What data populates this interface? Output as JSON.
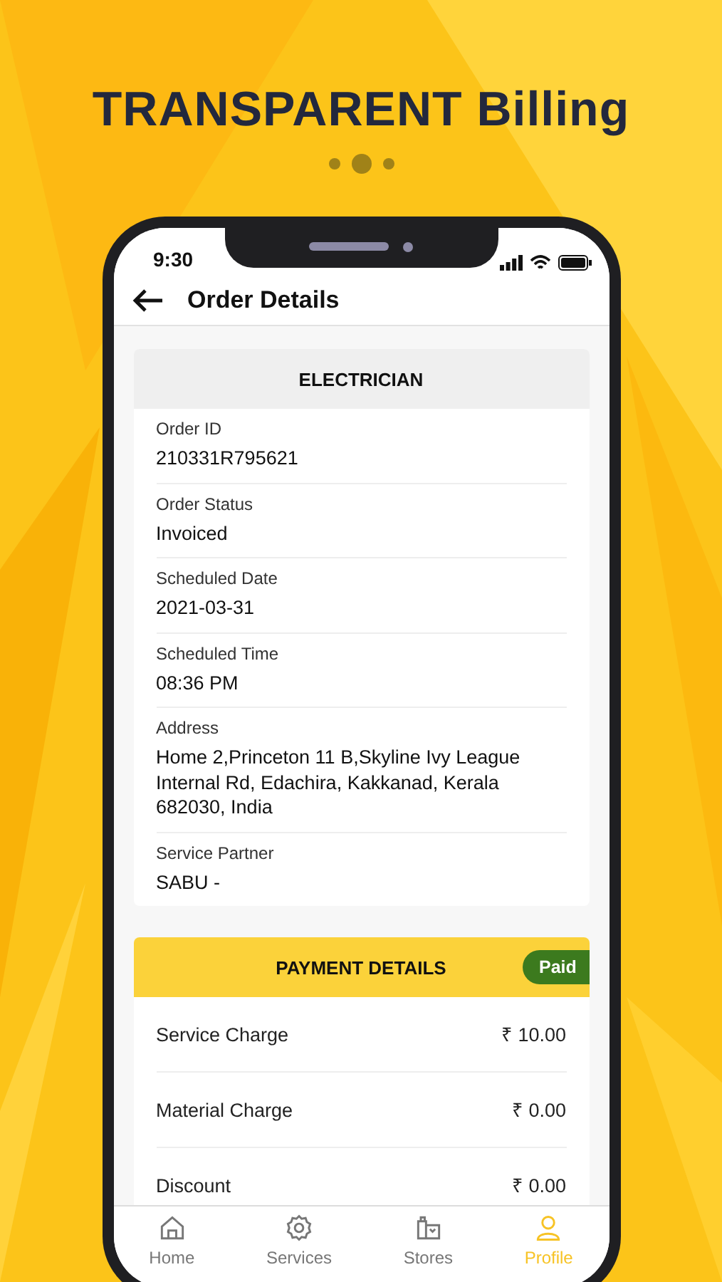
{
  "headline": "TRANSPARENT Billing",
  "pager": [
    {
      "selected": false
    },
    {
      "selected": true
    },
    {
      "selected": false
    }
  ],
  "status_bar": {
    "time": "9:30"
  },
  "header": {
    "title": "Order Details"
  },
  "order_card": {
    "title": "ELECTRICIAN",
    "fields": [
      {
        "label": "Order ID",
        "value": "210331R795621"
      },
      {
        "label": "Order Status",
        "value": "Invoiced"
      },
      {
        "label": "Scheduled Date",
        "value": "2021-03-31"
      },
      {
        "label": "Scheduled Time",
        "value": "08:36 PM"
      },
      {
        "label": "Address",
        "value": "Home 2,Princeton 11 B,Skyline Ivy League Internal Rd, Edachira, Kakkanad, Kerala 682030, India"
      },
      {
        "label": "Service Partner",
        "value": "SABU -"
      }
    ]
  },
  "payment_card": {
    "title": "PAYMENT DETAILS",
    "badge": "Paid",
    "rows": [
      {
        "label": "Service Charge",
        "amount": "₹ 10.00"
      },
      {
        "label": "Material Charge",
        "amount": "₹ 0.00"
      },
      {
        "label": "Discount",
        "amount": "₹ 0.00"
      }
    ]
  },
  "nav": [
    {
      "kind": "home",
      "label": "Home",
      "selected": false
    },
    {
      "kind": "services",
      "label": "Services",
      "selected": false
    },
    {
      "kind": "stores",
      "label": "Stores",
      "selected": false
    },
    {
      "kind": "profile",
      "label": "Profile",
      "selected": true
    }
  ]
}
